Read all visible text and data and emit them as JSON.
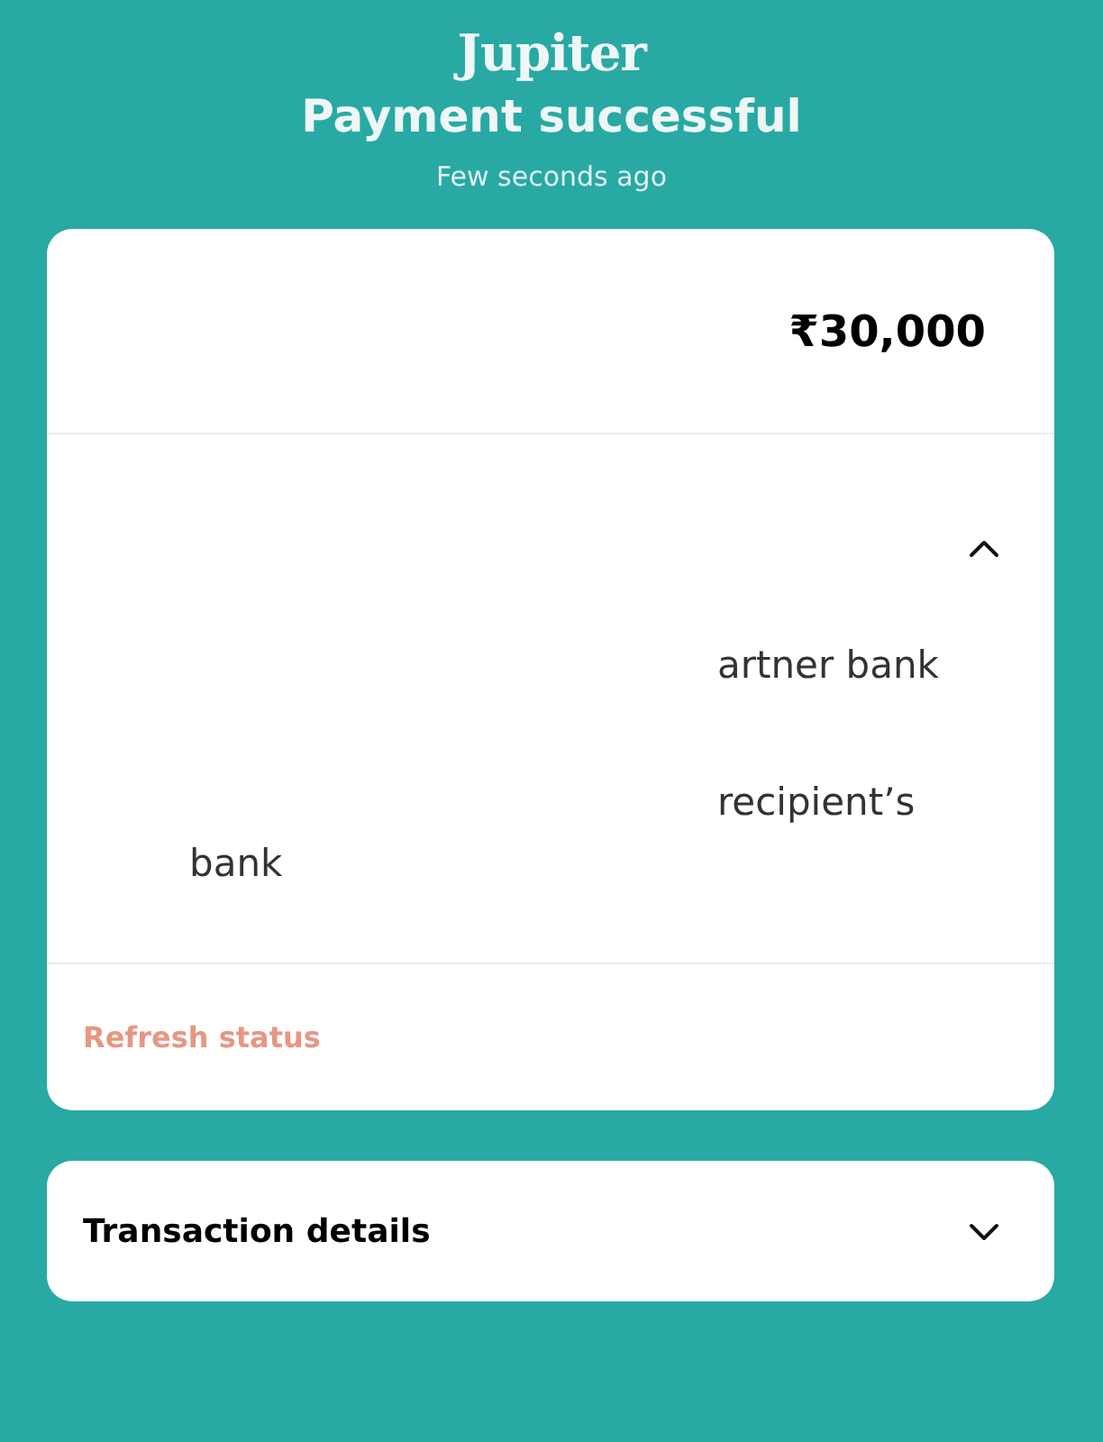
{
  "header": {
    "brand": "Jupiter",
    "title": "Payment successful",
    "time": "Few seconds ago"
  },
  "summary": {
    "amount": "₹30,000"
  },
  "status_section": {
    "expanded": true,
    "lines": [
      "artner bank",
      "recipient’s"
    ],
    "wrapped_line": "bank",
    "action": "Refresh status"
  },
  "details_section": {
    "title": "Transaction details",
    "expanded": false
  }
}
